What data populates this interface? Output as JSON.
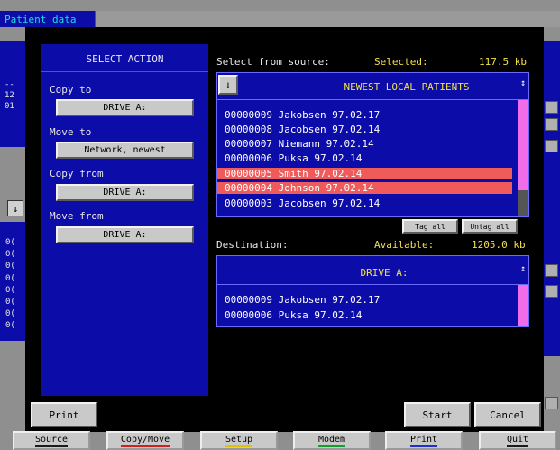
{
  "background": {
    "title": "Patient data",
    "left_text_top": "--\n12\n01",
    "left_text_bottom": "0(\n0(\n0(\n0(\n0(\n0(\n0(\n0(",
    "left_arrow": "↓"
  },
  "action": {
    "title": "SELECT ACTION",
    "copy_to_label": "Copy to",
    "copy_to_value": "DRIVE A:",
    "move_to_label": "Move to",
    "move_to_value": "Network, newest",
    "copy_from_label": "Copy from",
    "copy_from_value": "DRIVE A:",
    "move_from_label": "Move from",
    "move_from_value": "DRIVE A:"
  },
  "source": {
    "header": "Select from source:",
    "selected_label": "Selected:",
    "selected_value": "117.5 kb",
    "arrow_icon": "↓",
    "list_title": "NEWEST LOCAL PATIENTS",
    "scroll_icon": "↕",
    "rows": [
      {
        "text": "00000009 Jakobsen 97.02.17",
        "selected": false
      },
      {
        "text": "00000008 Jacobsen 97.02.14",
        "selected": false
      },
      {
        "text": "00000007 Niemann 97.02.14",
        "selected": false
      },
      {
        "text": "00000006 Puksa 97.02.14",
        "selected": false
      },
      {
        "text": "00000005 Smith 97.02.14",
        "selected": true
      },
      {
        "text": "00000004 Johnson 97.02.14",
        "selected": true
      },
      {
        "text": "00000003 Jacobsen 97.02.14",
        "selected": false
      }
    ],
    "tag_all": "Tag all",
    "untag_all": "Untag all"
  },
  "destination": {
    "header": "Destination:",
    "available_label": "Available:",
    "available_value": "1205.0 kb",
    "title": "DRIVE A:",
    "scroll_icon": "↕",
    "rows": [
      "00000009 Jakobsen 97.02.17",
      "00000006 Puksa 97.02.14"
    ]
  },
  "buttons": {
    "print": "Print",
    "start": "Start",
    "cancel": "Cancel"
  },
  "tabs": [
    {
      "label": "Source",
      "underline": "#1a1a1a"
    },
    {
      "label": "Copy/Move",
      "underline": "#d02020"
    },
    {
      "label": "Setup",
      "underline": "#e0c000"
    },
    {
      "label": "Modem",
      "underline": "#10a030"
    },
    {
      "label": "Print",
      "underline": "#2030d0"
    },
    {
      "label": "Quit",
      "underline": "#1a1a1a"
    }
  ],
  "colors": {
    "panel_blue": "#0c0ca8",
    "highlight_yellow": "#f2e04a",
    "selected_row": "#ef5a5a",
    "scrollbar": "#f06ce8",
    "title_cyan": "#19e0d6"
  }
}
